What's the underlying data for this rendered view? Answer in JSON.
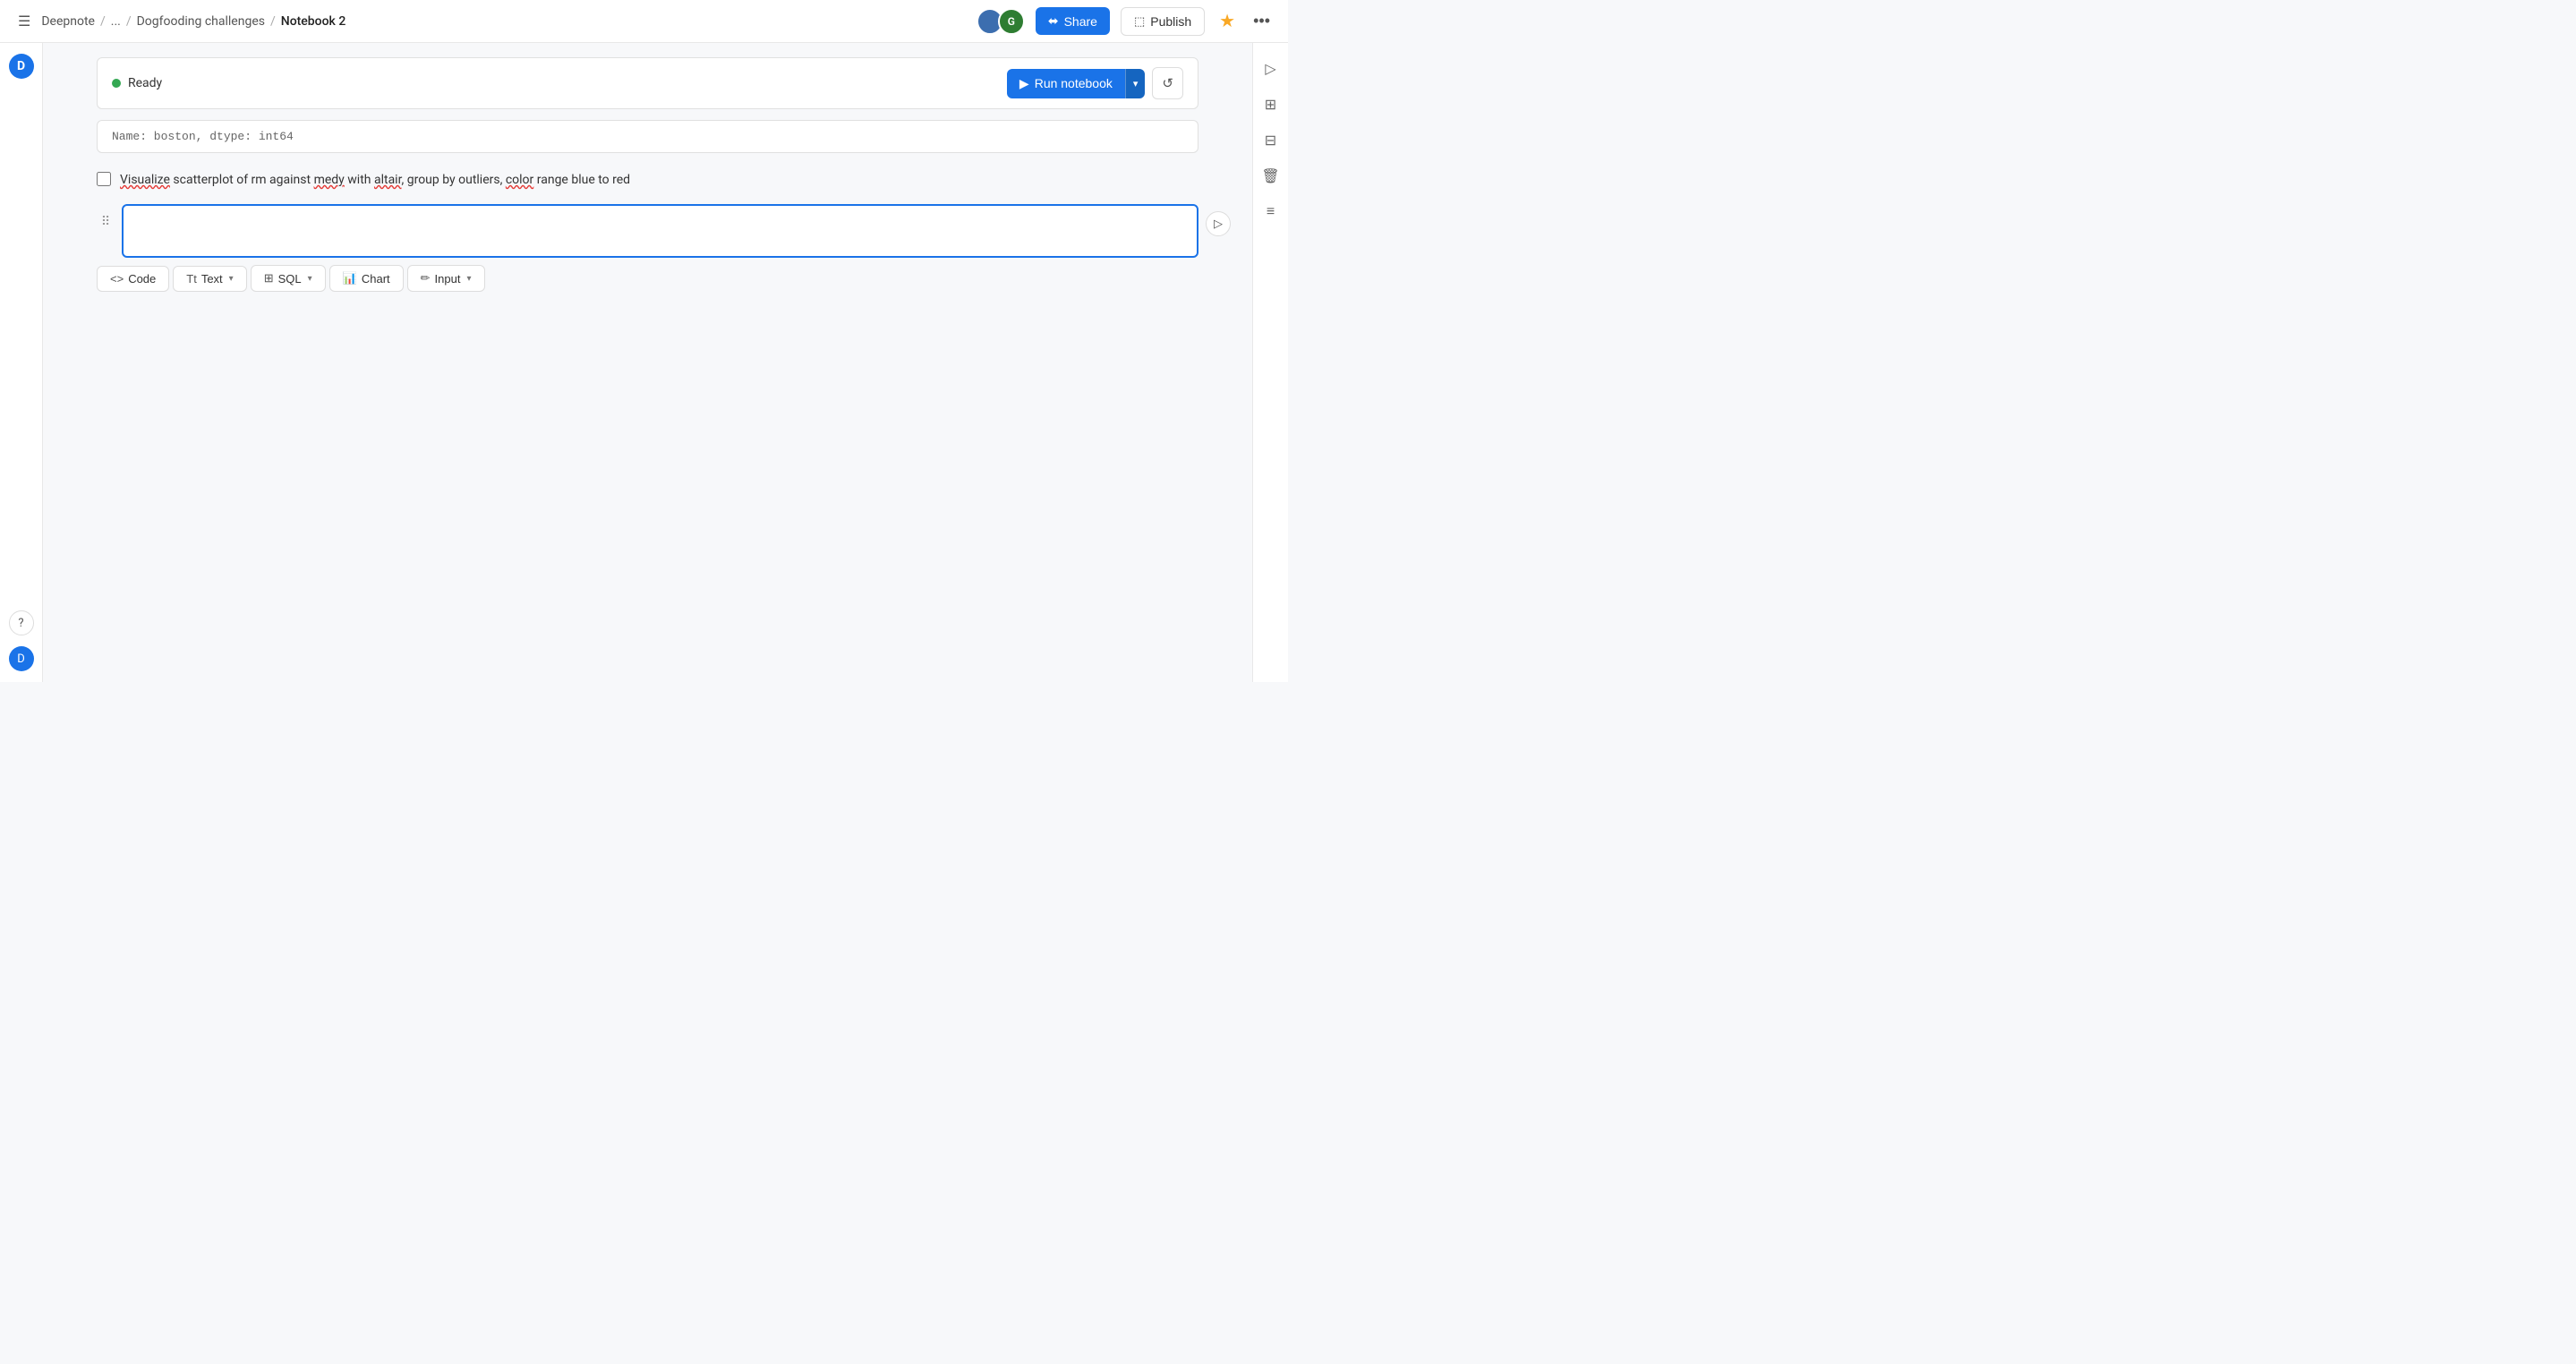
{
  "topnav": {
    "app_name": "Deepnote",
    "breadcrumb_sep1": "/",
    "breadcrumb_ellipsis": "...",
    "breadcrumb_sep2": "/",
    "breadcrumb_project": "Dogfooding challenges",
    "breadcrumb_sep3": "/",
    "breadcrumb_current": "Notebook 2",
    "share_label": "Share",
    "publish_label": "Publish",
    "star_icon": "★",
    "more_icon": "···"
  },
  "status_bar": {
    "status_text": "Ready",
    "run_label": "Run notebook",
    "refresh_icon": "↺"
  },
  "partial_code": {
    "text": "Name: boston, dtype: int64"
  },
  "checkbox_cell": {
    "label_parts": [
      "Visualize scatterplot of rm against medy with altair, group by outliers, color range blue to red"
    ],
    "checked": false
  },
  "active_cell": {
    "placeholder": "",
    "cursor_visible": true
  },
  "cell_toolbar": {
    "buttons": [
      {
        "icon": "<>",
        "label": "Code",
        "has_caret": false
      },
      {
        "icon": "Tt",
        "label": "Text",
        "has_caret": true
      },
      {
        "icon": "≡",
        "label": "SQL",
        "has_caret": true
      },
      {
        "icon": "📊",
        "label": "Chart",
        "has_caret": false
      },
      {
        "icon": "✏",
        "label": "Input",
        "has_caret": true
      }
    ]
  },
  "right_panel": {
    "icons": [
      "▷",
      "⊞",
      "⊟",
      "🗑",
      "≡"
    ]
  },
  "sidebar": {
    "hamburger": "☰",
    "logo": "D"
  },
  "colors": {
    "accent_blue": "#1a73e8",
    "status_green": "#34a853",
    "border": "#e0e0e0",
    "text_primary": "#333",
    "text_secondary": "#666"
  }
}
